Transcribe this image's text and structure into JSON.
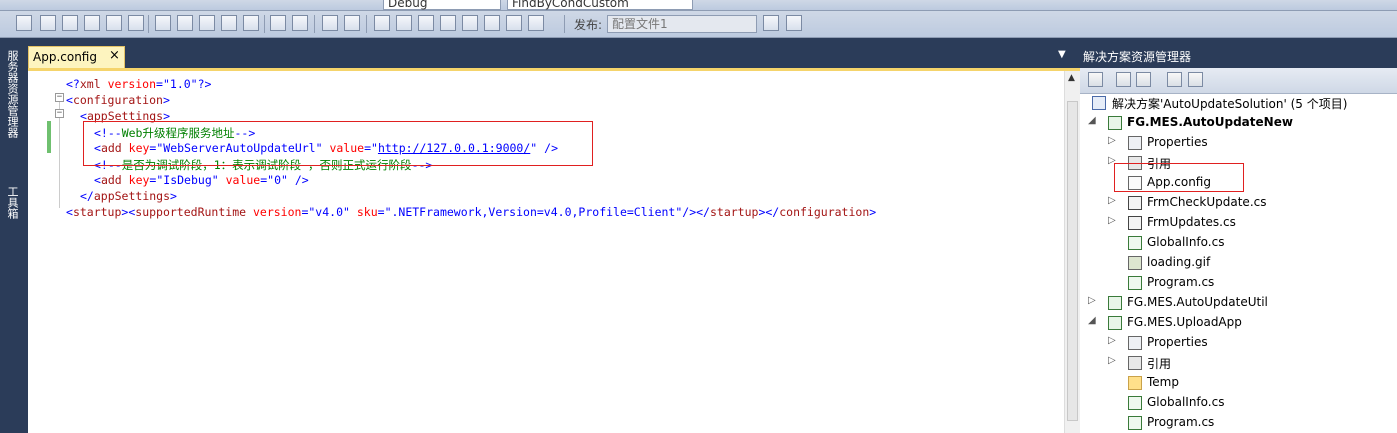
{
  "toolbar": {
    "config_value": "Debug",
    "find_value": "FindByCondCustom",
    "publish_label": "发布:",
    "profile_value": "配置文件1"
  },
  "left_strip": {
    "server_explorer": "服务器资源管理器",
    "toolbox": "工具箱"
  },
  "editor": {
    "tab_title": "App.config",
    "close_glyph": "×",
    "lines": [
      {
        "indent": 0,
        "parts": [
          [
            "bl",
            "<?"
          ],
          [
            "tag",
            "xml"
          ],
          [
            "attr",
            " version"
          ],
          [
            "bl",
            "="
          ],
          [
            "val",
            "\"1.0\""
          ],
          [
            "bl",
            "?>"
          ]
        ]
      },
      {
        "indent": 0,
        "parts": [
          [
            "bl",
            "<"
          ],
          [
            "tag",
            "configuration"
          ],
          [
            "bl",
            ">"
          ]
        ]
      },
      {
        "indent": 1,
        "parts": [
          [
            "bl",
            "<"
          ],
          [
            "tag",
            "appSettings"
          ],
          [
            "bl",
            ">"
          ]
        ]
      },
      {
        "indent": 2,
        "parts": [
          [
            "bl",
            "<!--"
          ],
          [
            "cmt",
            "Web升级程序服务地址"
          ],
          [
            "bl",
            "-->"
          ]
        ]
      },
      {
        "indent": 2,
        "parts": [
          [
            "bl",
            "<"
          ],
          [
            "tag",
            "add"
          ],
          [
            "attr",
            " key"
          ],
          [
            "bl",
            "="
          ],
          [
            "val",
            "\"WebServerAutoUpdateUrl\""
          ],
          [
            "attr",
            " value"
          ],
          [
            "bl",
            "="
          ],
          [
            "bl",
            "\""
          ],
          [
            "link",
            "http://127.0.0.1:9000/"
          ],
          [
            "bl",
            "\""
          ],
          [
            "bl",
            " />"
          ]
        ]
      },
      {
        "indent": 2,
        "parts": [
          [
            "bl",
            "<!--"
          ],
          [
            "cmt",
            "是否为调试阶段，1：表示调试阶段 ，否则正式运行阶段"
          ],
          [
            "bl",
            "-->"
          ]
        ]
      },
      {
        "indent": 2,
        "parts": [
          [
            "bl",
            "<"
          ],
          [
            "tag",
            "add"
          ],
          [
            "attr",
            " key"
          ],
          [
            "bl",
            "="
          ],
          [
            "val",
            "\"IsDebug\""
          ],
          [
            "attr",
            " value"
          ],
          [
            "bl",
            "="
          ],
          [
            "val",
            "\"0\""
          ],
          [
            "bl",
            " />"
          ]
        ]
      },
      {
        "indent": 1,
        "parts": [
          [
            "bl",
            "</"
          ],
          [
            "tag",
            "appSettings"
          ],
          [
            "bl",
            ">"
          ]
        ]
      },
      {
        "indent": 0,
        "parts": [
          [
            "bl",
            "<"
          ],
          [
            "tag",
            "startup"
          ],
          [
            "bl",
            "><"
          ],
          [
            "tag",
            "supportedRuntime"
          ],
          [
            "attr",
            " version"
          ],
          [
            "bl",
            "="
          ],
          [
            "val",
            "\"v4.0\""
          ],
          [
            "attr",
            " sku"
          ],
          [
            "bl",
            "="
          ],
          [
            "val",
            "\".NETFramework,Version=v4.0,Profile=Client\""
          ],
          [
            "bl",
            "/></"
          ],
          [
            "tag",
            "startup"
          ],
          [
            "bl",
            "></"
          ],
          [
            "tag",
            "configuration"
          ],
          [
            "bl",
            ">"
          ]
        ]
      }
    ]
  },
  "solution_explorer": {
    "title": "解决方案资源管理器",
    "nodes": [
      {
        "label": "解决方案'AutoUpdateSolution' (5 个项目)",
        "icon": "sol",
        "level": 0,
        "exp": "",
        "bold": false
      },
      {
        "label": "FG.MES.AutoUpdateNew",
        "icon": "proj",
        "level": 0,
        "exp": "◢",
        "bold": true
      },
      {
        "label": "Properties",
        "icon": "props",
        "level": 1,
        "exp": "▷",
        "bold": false
      },
      {
        "label": "引用",
        "icon": "ref",
        "level": 1,
        "exp": "▷",
        "bold": false
      },
      {
        "label": "App.config",
        "icon": "cfg",
        "level": 1,
        "exp": "",
        "bold": false
      },
      {
        "label": "FrmCheckUpdate.cs",
        "icon": "csx",
        "level": 1,
        "exp": "▷",
        "bold": false
      },
      {
        "label": "FrmUpdates.cs",
        "icon": "csx",
        "level": 1,
        "exp": "▷",
        "bold": false
      },
      {
        "label": "GlobalInfo.cs",
        "icon": "cs",
        "level": 1,
        "exp": "",
        "bold": false
      },
      {
        "label": "loading.gif",
        "icon": "gif",
        "level": 1,
        "exp": "",
        "bold": false
      },
      {
        "label": "Program.cs",
        "icon": "cs",
        "level": 1,
        "exp": "",
        "bold": false
      },
      {
        "label": "FG.MES.AutoUpdateUtil",
        "icon": "proj",
        "level": 0,
        "exp": "▷",
        "bold": false
      },
      {
        "label": "FG.MES.UploadApp",
        "icon": "proj",
        "level": 0,
        "exp": "◢",
        "bold": false
      },
      {
        "label": "Properties",
        "icon": "props",
        "level": 1,
        "exp": "▷",
        "bold": false
      },
      {
        "label": "引用",
        "icon": "ref",
        "level": 1,
        "exp": "▷",
        "bold": false
      },
      {
        "label": "Temp",
        "icon": "folder",
        "level": 1,
        "exp": "",
        "bold": false
      },
      {
        "label": "GlobalInfo.cs",
        "icon": "cs",
        "level": 1,
        "exp": "",
        "bold": false
      },
      {
        "label": "Program.cs",
        "icon": "cs",
        "level": 1,
        "exp": "",
        "bold": false
      }
    ]
  }
}
